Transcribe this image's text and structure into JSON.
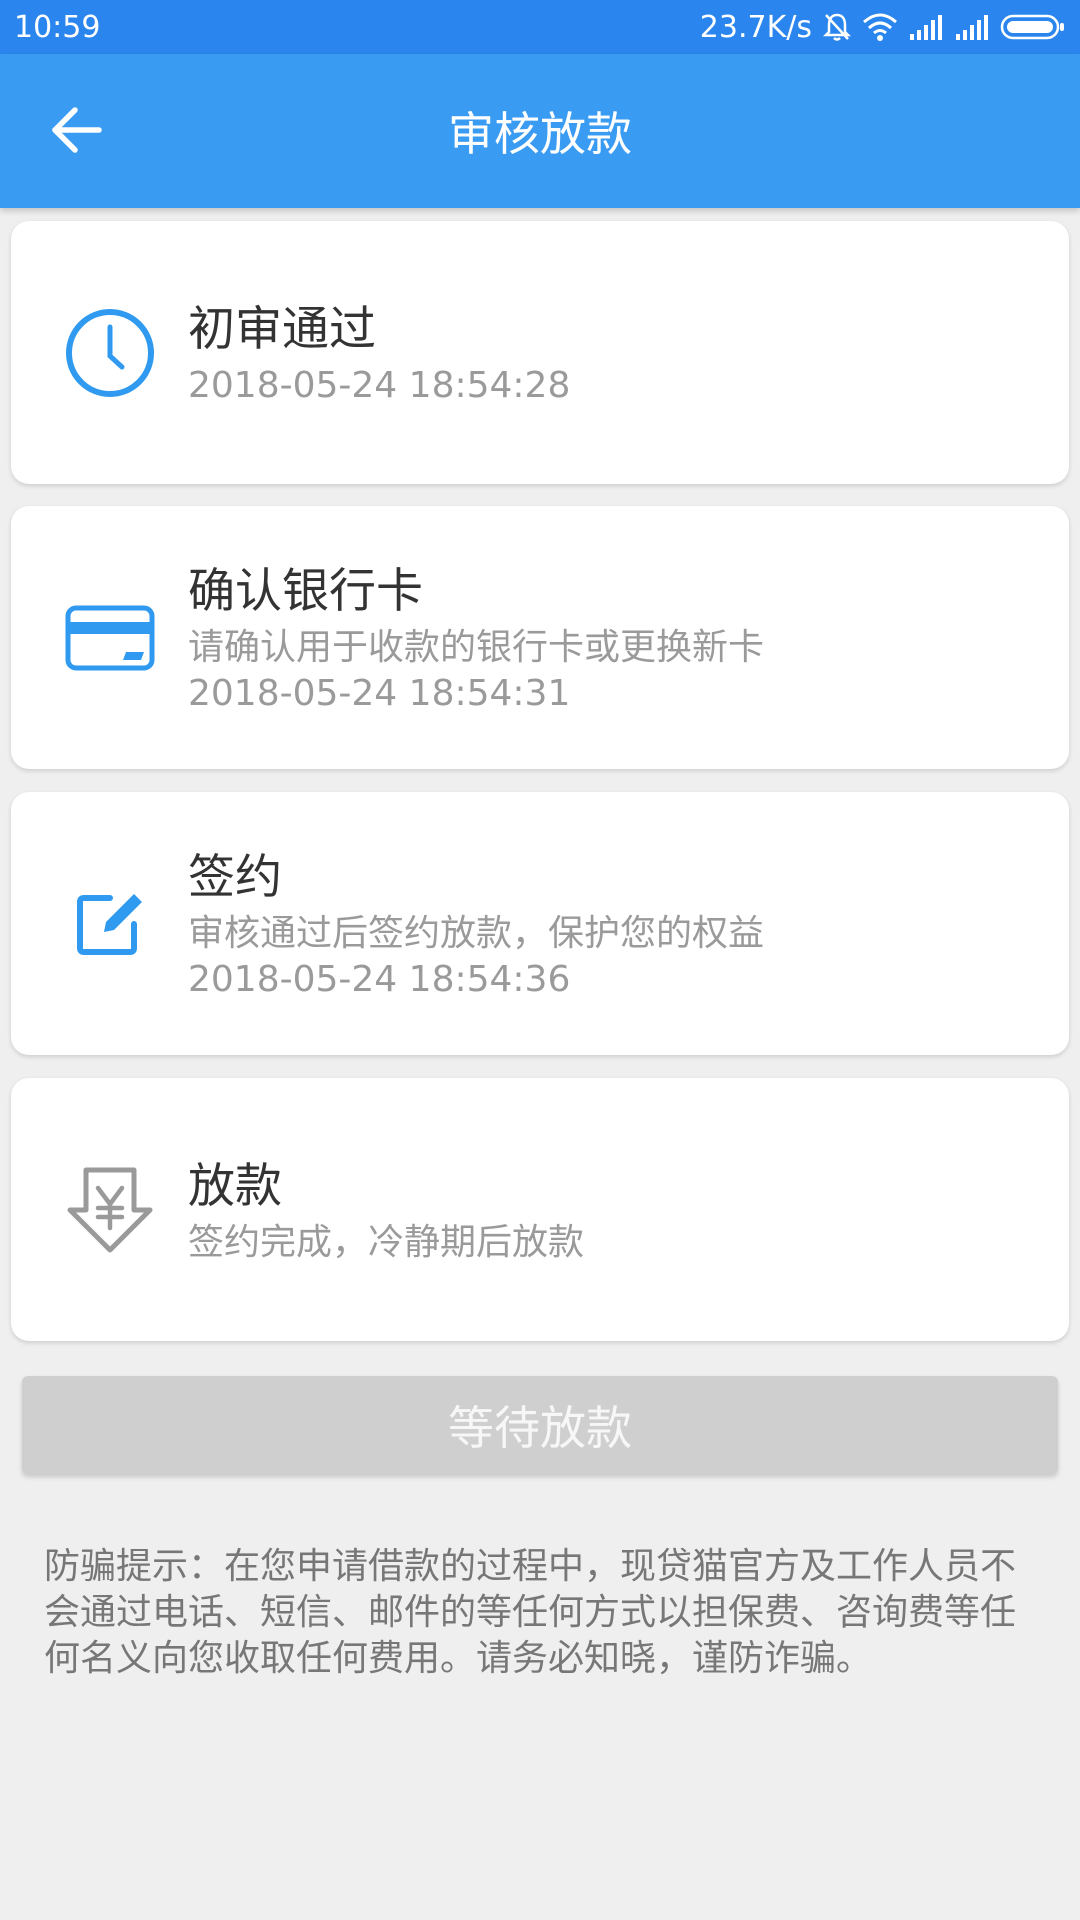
{
  "status_bar": {
    "time": "10:59",
    "net_speed": "23.7K/s",
    "icons": [
      "bell-muted-icon",
      "wifi-icon",
      "signal-icon",
      "signal-icon",
      "battery-icon"
    ]
  },
  "header": {
    "title": "审核放款",
    "back_icon": "arrow-left-icon"
  },
  "steps": [
    {
      "icon": "clock-icon",
      "title": "初审通过",
      "subtitle": "",
      "time": "2018-05-24 18:54:28",
      "color": "#2f9af0"
    },
    {
      "icon": "bank-card-icon",
      "title": "确认银行卡",
      "subtitle": "请确认用于收款的银行卡或更换新卡",
      "time": "2018-05-24 18:54:31",
      "color": "#2f9af0"
    },
    {
      "icon": "edit-icon",
      "title": "签约",
      "subtitle": "审核通过后签约放款，保护您的权益",
      "time": "2018-05-24 18:54:36",
      "color": "#2f9af0"
    },
    {
      "icon": "yuan-down-icon",
      "title": "放款",
      "subtitle": "签约完成，冷静期后放款",
      "time": "",
      "color": "#9a9a9a"
    }
  ],
  "action": {
    "label": "等待放款"
  },
  "notice": {
    "text": "防骗提示：在您申请借款的过程中，现贷猫官方及工作人员不会通过电话、短信、邮件的等任何方式以担保费、咨询费等任何名义向您收取任何费用。请务必知晓，谨防诈骗。"
  },
  "colors": {
    "status_bar": "#2a86ee",
    "app_bar": "#3a9bf3",
    "accent": "#2f9af0",
    "disabled_button": "#cfcfcf",
    "background": "#efefef"
  }
}
